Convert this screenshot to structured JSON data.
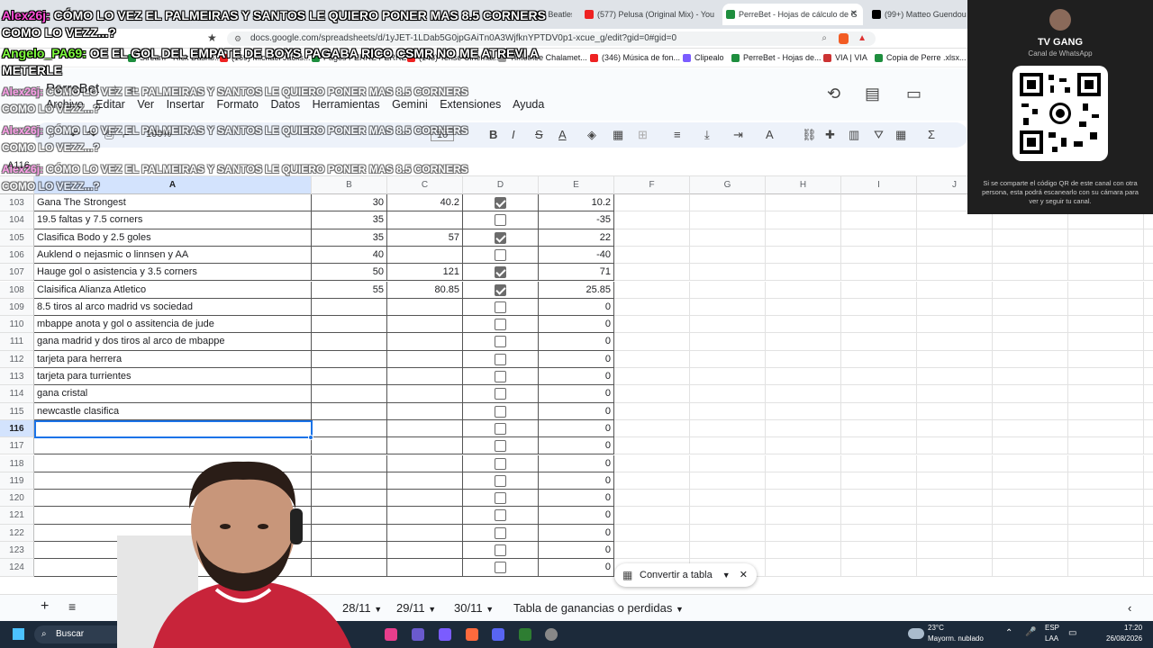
{
  "browser": {
    "tabs": [
      {
        "label": "Alex26j: CÓMO LO VEZ...",
        "active": false
      },
      {
        "label": "s - The Beatles - He",
        "active": false
      },
      {
        "label": "(577) Pelusa (Original Mix) - You",
        "active": false
      },
      {
        "label": "PerreBet - Hojas de cálculo de G",
        "active": true
      },
      {
        "label": "(99+) Matteo Guendou",
        "active": false
      }
    ],
    "url": "docs.google.com/spreadsheets/d/1yJET-1LDab5G0jpGAiTn0A3WjfknYPTDV0p1-xcue_g/edit?gid=0#gid=0",
    "bookmarks": [
      "Stream - Rick Dashb...",
      "(169) Michael Jacks...",
      "Pagos PERRE PERRE...",
      "(148) Tense Cinemat...",
      "Timothée Chalamet...",
      "(346) Música de fon...",
      "Clipealo",
      "PerreBet - Hojas de...",
      "VIA | VIA",
      "Copia de Perre .xlsx..."
    ]
  },
  "sheets": {
    "title": "PerreBet",
    "menu": [
      "Archivo",
      "Editar",
      "Ver",
      "Insertar",
      "Formato",
      "Datos",
      "Herramientas",
      "Gemini",
      "Extensiones",
      "Ayuda"
    ],
    "zoom": "100%",
    "font_size": "10",
    "cell_ref": "A116",
    "columns": [
      "A",
      "B",
      "C",
      "D",
      "E",
      "F",
      "G",
      "H",
      "I",
      "J"
    ],
    "rows": [
      {
        "n": "103",
        "a": "Gana The Strongest",
        "b": "30",
        "c": "40.2",
        "d": true,
        "e": "10.2"
      },
      {
        "n": "104",
        "a": "19.5 faltas y 7.5 corners",
        "b": "35",
        "c": "",
        "d": false,
        "e": "-35"
      },
      {
        "n": "105",
        "a": "Clasifica Bodo y 2.5 goles",
        "b": "35",
        "c": "57",
        "d": true,
        "e": "22"
      },
      {
        "n": "106",
        "a": "Auklend o nejasmic o linnsen y AA",
        "b": "40",
        "c": "",
        "d": false,
        "e": "-40"
      },
      {
        "n": "107",
        "a": "Hauge gol o asistencia y 3.5 corners",
        "b": "50",
        "c": "121",
        "d": true,
        "e": "71"
      },
      {
        "n": "108",
        "a": "Claisifica Alianza Atletico",
        "b": "55",
        "c": "80.85",
        "d": true,
        "e": "25.85"
      },
      {
        "n": "109",
        "a": "8.5 tiros al arco madrid vs sociedad",
        "b": "",
        "c": "",
        "d": false,
        "e": "0"
      },
      {
        "n": "110",
        "a": "mbappe anota y gol o assitencia de jude",
        "b": "",
        "c": "",
        "d": false,
        "e": "0"
      },
      {
        "n": "111",
        "a": "gana madrid y dos tiros al arco de mbappe",
        "b": "",
        "c": "",
        "d": false,
        "e": "0"
      },
      {
        "n": "112",
        "a": "tarjeta para herrera",
        "b": "",
        "c": "",
        "d": false,
        "e": "0"
      },
      {
        "n": "113",
        "a": "tarjeta para turrientes",
        "b": "",
        "c": "",
        "d": false,
        "e": "0"
      },
      {
        "n": "114",
        "a": "gana cristal",
        "b": "",
        "c": "",
        "d": false,
        "e": "0"
      },
      {
        "n": "115",
        "a": "newcastle clasifica",
        "b": "",
        "c": "",
        "d": false,
        "e": "0"
      },
      {
        "n": "116",
        "a": "",
        "b": "",
        "c": "",
        "d": false,
        "e": "0"
      },
      {
        "n": "117",
        "a": "",
        "b": "",
        "c": "",
        "d": false,
        "e": "0"
      },
      {
        "n": "118",
        "a": "",
        "b": "",
        "c": "",
        "d": false,
        "e": "0"
      },
      {
        "n": "119",
        "a": "",
        "b": "",
        "c": "",
        "d": false,
        "e": "0"
      },
      {
        "n": "120",
        "a": "",
        "b": "",
        "c": "",
        "d": false,
        "e": "0"
      },
      {
        "n": "121",
        "a": "",
        "b": "",
        "c": "",
        "d": false,
        "e": "0"
      },
      {
        "n": "122",
        "a": "",
        "b": "",
        "c": "",
        "d": false,
        "e": "0"
      },
      {
        "n": "123",
        "a": "",
        "b": "",
        "c": "",
        "d": false,
        "e": "0"
      },
      {
        "n": "124",
        "a": "",
        "b": "",
        "c": "",
        "d": false,
        "e": "0"
      }
    ],
    "sheet_tabs": [
      "28/11",
      "29/11",
      "30/11",
      "Tabla de ganancias o perdidas"
    ],
    "convert_label": "Convertir a tabla"
  },
  "overlay": {
    "qr_title": "TV GANG",
    "qr_subtitle": "Canal de WhatsApp",
    "qr_caption": "Si se comparte el código QR de este canal con otra persona, esta podrá escanearlo con su cámara para ver y seguir tu canal.",
    "chat": [
      {
        "user": "Alex26j:",
        "text": " CÓMO LO VEZ EL PALMEIRAS Y SANTOS LE QUIERO PONER MAS 8.5 CORNERS",
        "text2": "COMO LO VEZZ...?",
        "style": "user"
      },
      {
        "user": "Angelo_PA69:",
        "text": " OE EL GOL DEL EMPATE DE BOYS PAGABA RICO CSMR NO ME ATREVI A",
        "text2": "METERLE",
        "style": "user2"
      },
      {
        "user": "Alex26j:",
        "text": " CÓMO LO VEZ EL PALMEIRAS Y SANTOS LE QUIERO PONER MAS 8.5 CORNERS",
        "text2": "COMO LO VEZZ...?",
        "style": "user"
      },
      {
        "user": "Alex26j:",
        "text": " CÓMO LO VEZ EL PALMEIRAS Y SANTOS LE QUIERO PONER MAS 8.5 CORNERS",
        "text2": "COMO LO VEZZ...?",
        "style": "user"
      },
      {
        "user": "Alex26j:",
        "text": " CÓMO LO VEZ EL PALMEIRAS Y SANTOS LE QUIERO PONER MAS 8.5 CORNERS",
        "text2": "COMO LO VEZZ...?",
        "style": "user"
      }
    ]
  },
  "taskbar": {
    "search": "Buscar",
    "weather_temp": "23°C",
    "weather_desc": "Mayorm. nublado",
    "lang1": "ESP",
    "lang2": "LAA",
    "time": "17:20",
    "date": "26/08/2026"
  }
}
